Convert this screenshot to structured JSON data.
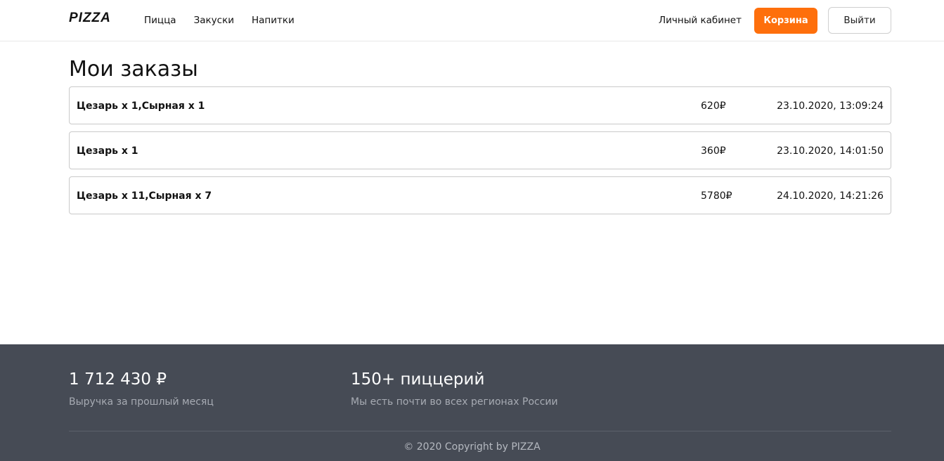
{
  "header": {
    "logo": "PIZZA",
    "nav": [
      "Пицца",
      "Закуски",
      "Напитки"
    ],
    "account_label": "Личный кабинет",
    "cart_label": "Корзина",
    "logout_label": "Выйти"
  },
  "main": {
    "title": "Мои заказы",
    "orders": [
      {
        "items": "Цезарь x 1,Сырная x 1",
        "price": "620₽",
        "date": "23.10.2020, 13:09:24"
      },
      {
        "items": "Цезарь x 1",
        "price": "360₽",
        "date": "23.10.2020, 14:01:50"
      },
      {
        "items": "Цезарь x 11,Сырная x 7",
        "price": "5780₽",
        "date": "24.10.2020, 14:21:26"
      }
    ]
  },
  "footer": {
    "stats": [
      {
        "value": "1 712 430 ₽",
        "caption": "Выручка за прошлый месяц"
      },
      {
        "value": "150+ пиццерий",
        "caption": "Мы есть почти во всех регионах России"
      }
    ],
    "copyright": "© 2020 Copyright by PIZZA"
  },
  "colors": {
    "accent": "#fe6f0c",
    "footer_bg": "#464b55"
  }
}
